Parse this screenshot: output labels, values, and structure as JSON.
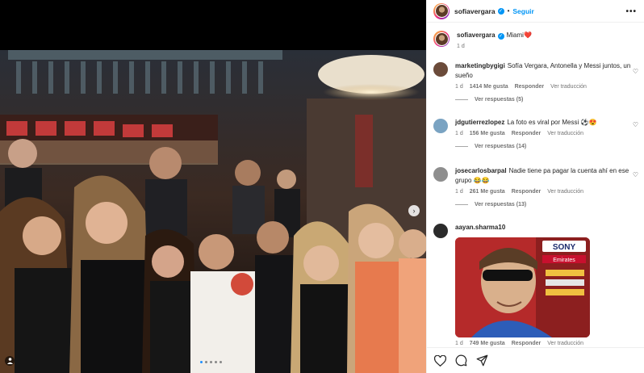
{
  "post": {
    "author": "sofiavergara",
    "follow_label": "Seguir",
    "separator": "•",
    "more_label": "•••",
    "caption_text": "Miami",
    "caption_emoji": "❤️",
    "caption_age": "1 d",
    "carousel_next": "›",
    "carousel_dots": 5,
    "carousel_active": 0
  },
  "comments": [
    {
      "username": "marketingbygigi",
      "text": "Sofía Vergara, Antonella y Messi juntos, un sueño",
      "age": "1 d",
      "likes": "1414 Me gusta",
      "reply_label": "Responder",
      "translate_label": "Ver traducción",
      "replies_label": "Ver respuestas (5)",
      "avatar_color": "#6b4b3a"
    },
    {
      "username": "jdgutierrezlopez",
      "text": "La foto es viral por Messi ⚽😍",
      "age": "1 d",
      "likes": "156 Me gusta",
      "reply_label": "Responder",
      "translate_label": "Ver traducción",
      "replies_label": "Ver respuestas (14)",
      "avatar_color": "#7aa3c2"
    },
    {
      "username": "josecarlosbarpal",
      "text": "Nadie tiene pa pagar la cuenta ahí en ese grupo 😂😂",
      "age": "1 d",
      "likes": "261 Me gusta",
      "reply_label": "Responder",
      "translate_label": "Ver traducción",
      "replies_label": "Ver respuestas (13)",
      "avatar_color": "#8e8e8e"
    },
    {
      "username": "aayan.sharma10",
      "text": "",
      "age": "1 d",
      "likes": "749 Me gusta",
      "reply_label": "Responder",
      "translate_label": "Ver traducción",
      "replies_label": "",
      "avatar_color": "#2b2b2b"
    }
  ],
  "gif": {
    "banner_text": "SONY",
    "sponsor_text": "Emirates"
  },
  "actions": {
    "like_icon": "heart-outline-icon",
    "comment_icon": "comment-bubble-icon",
    "share_icon": "paper-plane-icon"
  }
}
